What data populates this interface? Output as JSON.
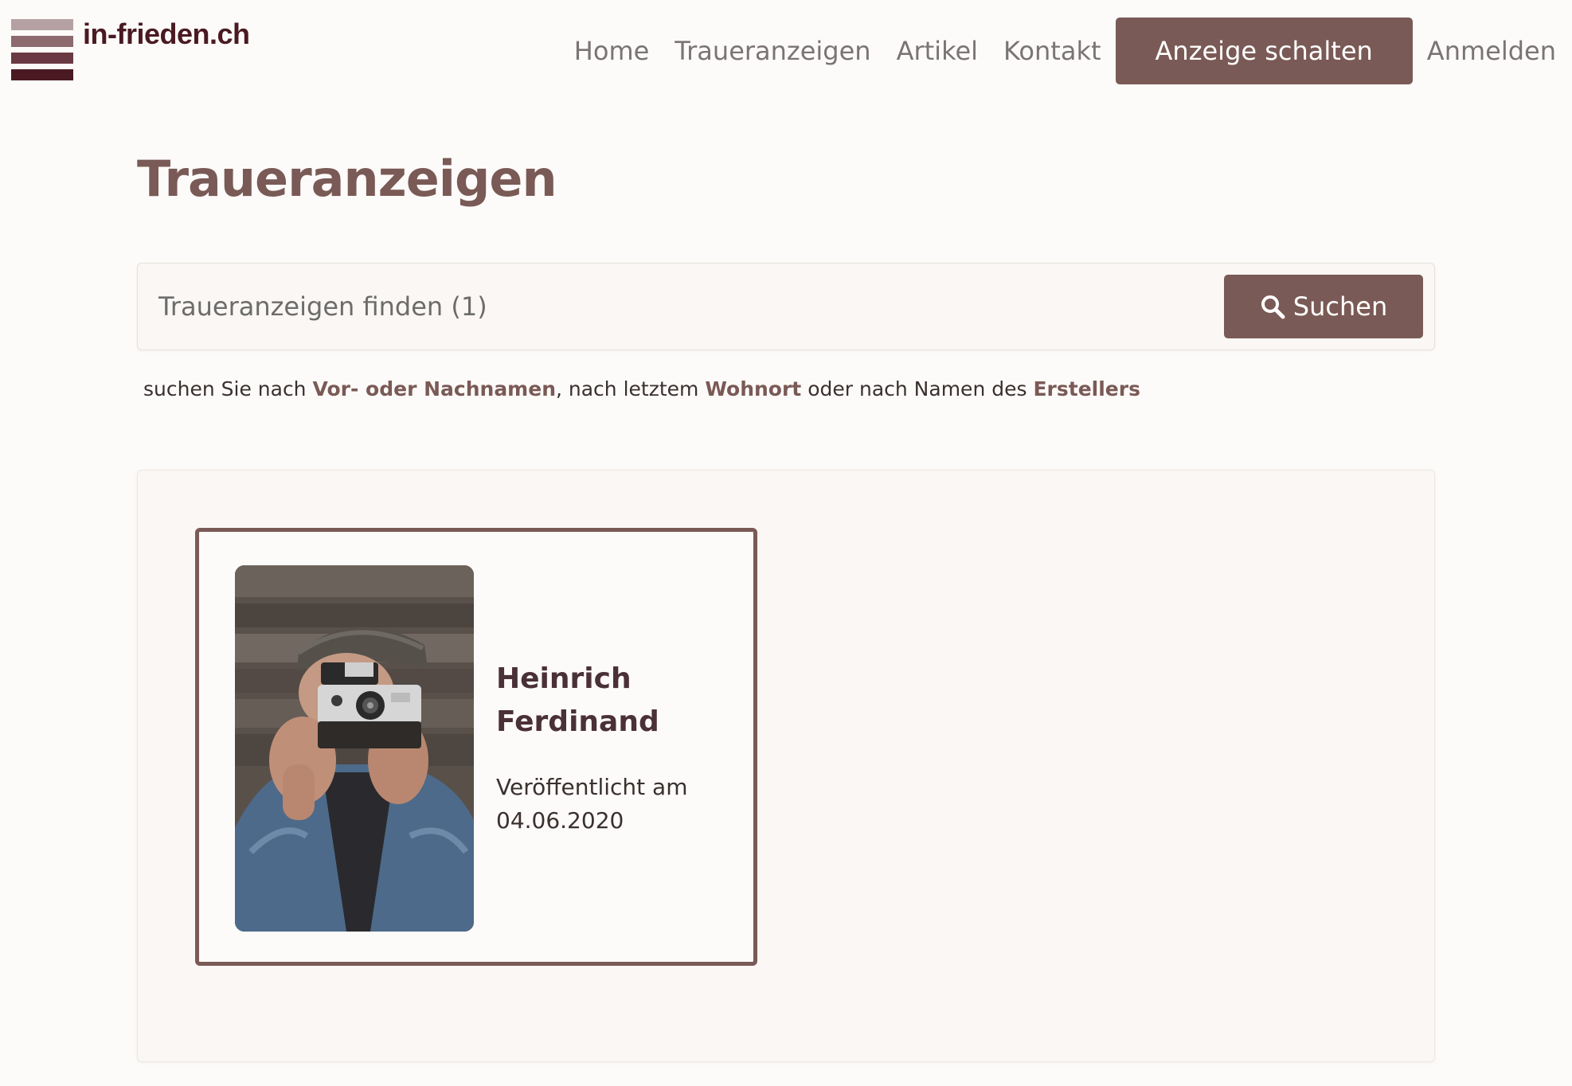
{
  "header": {
    "logo_text": "in-frieden.ch",
    "logo_colors": [
      "#b5a1a3",
      "#8c6a6e",
      "#6a3a42",
      "#4a1a22"
    ],
    "nav": [
      {
        "label": "Home"
      },
      {
        "label": "Traueranzeigen"
      },
      {
        "label": "Artikel"
      },
      {
        "label": "Kontakt"
      }
    ],
    "cta_label": "Anzeige schalten",
    "login_label": "Anmelden"
  },
  "main": {
    "title": "Traueranzeigen",
    "search": {
      "placeholder": "Traueranzeigen finden (1)",
      "button_label": "Suchen",
      "button_icon": "search-icon"
    },
    "hint": {
      "part1": "suchen Sie nach ",
      "bold1": "Vor- oder Nachnamen",
      "part2": ", nach letztem ",
      "bold2": "Wohnort",
      "part3": " oder nach Namen des ",
      "bold3": "Erstellers"
    },
    "results": [
      {
        "first_name": "Heinrich",
        "last_name": "Ferdinand",
        "published_label": "Veröffentlicht am",
        "published_date": "04.06.2020",
        "photo": "man-with-instant-camera-photo"
      }
    ]
  },
  "colors": {
    "accent": "#7a5a56",
    "background": "#fdfbf9",
    "logo_text": "#4a1a22"
  }
}
